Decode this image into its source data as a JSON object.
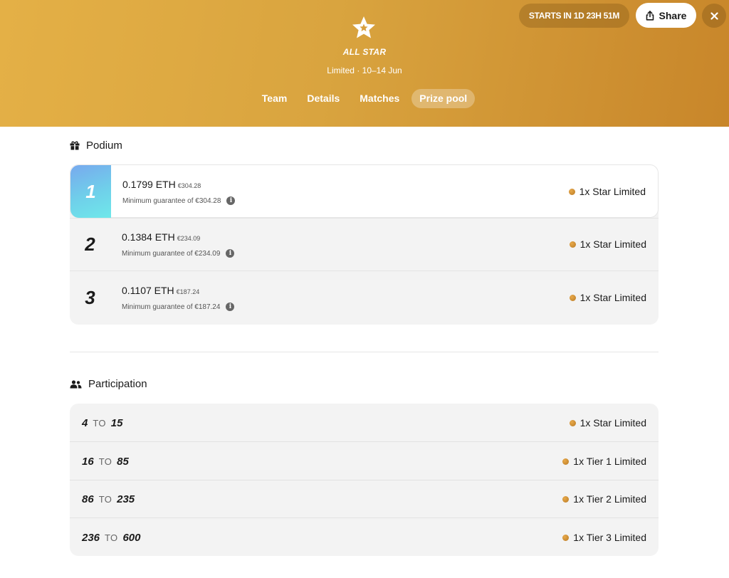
{
  "header": {
    "competition_name": "ALL STAR",
    "subtitle": "Limited · 10–14 Jun",
    "starts_in": "STARTS IN 1D 23H 51M",
    "share_label": "Share",
    "icons": {
      "logo": "star-icon",
      "share": "share-icon",
      "close": "close-icon"
    },
    "gradient": [
      "#e4b046",
      "#c8862a"
    ]
  },
  "tabs": [
    {
      "label": "Team",
      "active": false
    },
    {
      "label": "Details",
      "active": false
    },
    {
      "label": "Matches",
      "active": false
    },
    {
      "label": "Prize pool",
      "active": true
    }
  ],
  "podium": {
    "title": "Podium",
    "icon": "gift-icon",
    "rows": [
      {
        "rank": "1",
        "eth": "0.1799 ETH",
        "fiat": "€304.28",
        "guarantee": "Minimum guarantee of €304.28",
        "reward": "1x Star Limited"
      },
      {
        "rank": "2",
        "eth": "0.1384 ETH",
        "fiat": "€234.09",
        "guarantee": "Minimum guarantee of €234.09",
        "reward": "1x Star Limited"
      },
      {
        "rank": "3",
        "eth": "0.1107 ETH",
        "fiat": "€187.24",
        "guarantee": "Minimum guarantee of €187.24",
        "reward": "1x Star Limited"
      }
    ]
  },
  "participation": {
    "title": "Participation",
    "icon": "users-icon",
    "to_label": "TO",
    "rows": [
      {
        "from": "4",
        "to": "15",
        "reward": "1x Star Limited"
      },
      {
        "from": "16",
        "to": "85",
        "reward": "1x Tier 1 Limited"
      },
      {
        "from": "86",
        "to": "235",
        "reward": "1x Tier 2 Limited"
      },
      {
        "from": "236",
        "to": "600",
        "reward": "1x Tier 3 Limited"
      }
    ]
  },
  "colors": {
    "rank1_badge": "#6fd0ea",
    "reward_dot": "#c98a30"
  }
}
